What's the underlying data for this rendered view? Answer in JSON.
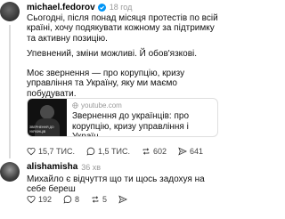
{
  "post": {
    "username": "michael.fedorov",
    "time": "18 год",
    "paragraph1": "Сьогодні, після понад місяця протестів по всій країні, хочу подякувати кожному за підтримку та активну позицію.",
    "paragraph2": "Упевнений, зміни можливі. Й обов'язкові.",
    "paragraph3": "Моє звернення — про корупцію, кризу управління та Україну, яку ми маємо побудувати.",
    "link": {
      "domain": "youtube.com",
      "title": "Звернення до українців: про корупцію, кризу управління і Україн...",
      "thumb_text": "ЗВЕРНЕННЯ ДО УКРАЇНЦІВ"
    },
    "actions": {
      "likes": "15,7 ТИС.",
      "comments": "1,5 ТИС.",
      "reposts": "602",
      "shares": "641"
    }
  },
  "reply": {
    "username": "alishamisha",
    "time": "36 хв",
    "text": "Михайло є відчуття що ти щось задохуя на себе береш",
    "actions": {
      "likes": "192",
      "comments": "8",
      "reposts": "5"
    }
  },
  "colors": {
    "verified": "#0095f6",
    "muted_text": "#999999"
  }
}
